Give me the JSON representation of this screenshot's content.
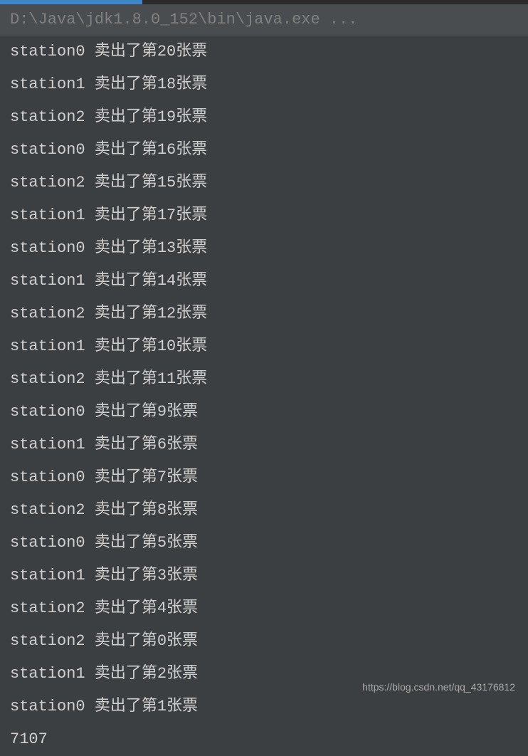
{
  "progress": {
    "percent": 27
  },
  "command": "D:\\Java\\jdk1.8.0_152\\bin\\java.exe ...",
  "lines": [
    "station0  卖出了第20张票",
    "station1  卖出了第18张票",
    "station2  卖出了第19张票",
    "station0  卖出了第16张票",
    "station2  卖出了第15张票",
    "station1  卖出了第17张票",
    "station0  卖出了第13张票",
    "station1  卖出了第14张票",
    "station2  卖出了第12张票",
    "station1  卖出了第10张票",
    "station2  卖出了第11张票",
    "station0  卖出了第9张票",
    "station1  卖出了第6张票",
    "station0  卖出了第7张票",
    "station2  卖出了第8张票",
    "station0  卖出了第5张票",
    "station1  卖出了第3张票",
    "station2  卖出了第4张票",
    "station2  卖出了第0张票",
    "station1  卖出了第2张票",
    "station0  卖出了第1张票",
    "7107"
  ],
  "watermark": "https://blog.csdn.net/qq_43176812"
}
